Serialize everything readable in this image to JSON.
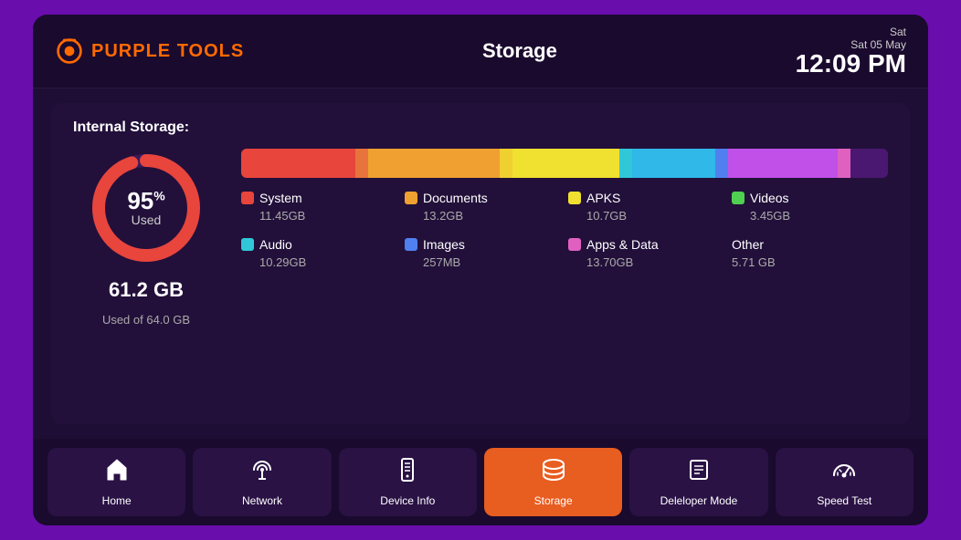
{
  "header": {
    "logo_purple": "PURPLE",
    "logo_tools": "TOOLS",
    "title": "Storage",
    "date": "Sat\n05 May",
    "time": "12:09 PM"
  },
  "storage": {
    "label": "Internal Storage:",
    "percent": "95",
    "percent_suffix": "%",
    "used_label": "Used",
    "total_size": "61.2 GB",
    "used_of": "Used of 64.0 GB",
    "bar_segments": [
      {
        "color": "#e8453c",
        "flex": 17.8
      },
      {
        "color": "#e8733c",
        "flex": 2
      },
      {
        "color": "#f0a030",
        "flex": 20.6
      },
      {
        "color": "#f0d030",
        "flex": 2
      },
      {
        "color": "#f0e030",
        "flex": 16.7
      },
      {
        "color": "#30c8d8",
        "flex": 2
      },
      {
        "color": "#30b8e8",
        "flex": 13
      },
      {
        "color": "#5080f0",
        "flex": 2
      },
      {
        "color": "#c050e8",
        "flex": 17
      },
      {
        "color": "#e060c0",
        "flex": 2
      },
      {
        "color": "#e868a8",
        "flex": 5.9
      }
    ],
    "legend": [
      {
        "label": "System",
        "size": "11.45GB",
        "color": "#e8453c"
      },
      {
        "label": "Documents",
        "size": "13.2GB",
        "color": "#f0a030"
      },
      {
        "label": "APKS",
        "size": "10.7GB",
        "color": "#f0e030"
      },
      {
        "label": "Videos",
        "size": "3.45GB",
        "color": "#50d050"
      },
      {
        "label": "Audio",
        "size": "10.29GB",
        "color": "#30c8d8"
      },
      {
        "label": "Images",
        "size": "257MB",
        "color": "#5080f0"
      },
      {
        "label": "Apps & Data",
        "size": "13.70GB",
        "color": "#e060c0"
      },
      {
        "label": "Other",
        "size": "5.71 GB",
        "color": "#888888"
      }
    ]
  },
  "nav": {
    "items": [
      {
        "label": "Home",
        "icon": "home",
        "active": false
      },
      {
        "label": "Network",
        "icon": "network",
        "active": false
      },
      {
        "label": "Device Info",
        "icon": "device",
        "active": false
      },
      {
        "label": "Storage",
        "icon": "storage",
        "active": true
      },
      {
        "label": "Deleloper Mode",
        "icon": "developer",
        "active": false
      },
      {
        "label": "Speed Test",
        "icon": "speedtest",
        "active": false
      }
    ]
  }
}
